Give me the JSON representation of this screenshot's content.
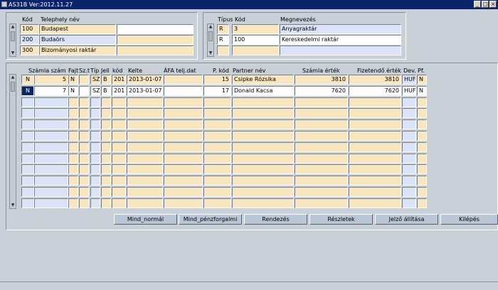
{
  "window": {
    "title": "AS31B Ver:2012.11.27"
  },
  "telephely": {
    "headers": {
      "kod": "Kód",
      "nev": "Telephely név"
    },
    "rows": [
      {
        "kod": "100",
        "nev": "Budapest"
      },
      {
        "kod": "200",
        "nev": "Budaörs"
      },
      {
        "kod": "300",
        "nev": "Bizományosi raktár"
      }
    ]
  },
  "raktar": {
    "headers": {
      "tipus": "Típus",
      "kod": "Kód",
      "megnevezes": "Megnevezés"
    },
    "rows": [
      {
        "tipus": "R",
        "kod": "3",
        "megnevezes": "Anyagraktár"
      },
      {
        "tipus": "R",
        "kod": "100",
        "megnevezes": "Kereskedelmi raktár"
      },
      {
        "tipus": "",
        "kod": "",
        "megnevezes": ""
      }
    ]
  },
  "szamlak": {
    "headers": {
      "szam": "Számla szám",
      "fajt": "Fajt",
      "szt": "Sz.t",
      "tip": "Típ",
      "jell": "Jell",
      "kod": "kód",
      "kelte": "Kelte",
      "afa": "ÁFA telj.dat",
      "pkod": "P. kód",
      "partner": "Partner név",
      "ertek": "Számla érték",
      "fizetendo": "Fizetendő érték",
      "dev": "Dev.",
      "pf": "Pf."
    },
    "rows": [
      {
        "prefix": "N",
        "szam": "5",
        "fajt": "N",
        "szt": "",
        "tip": "SZ",
        "jell": "B",
        "kod": "201",
        "kelte": "2013-01-07",
        "afa": "",
        "pkod": "15",
        "partner": "Csipke Rózsika",
        "ertek": "3810",
        "fizetendo": "3810",
        "dev": "HUF",
        "pf": "N"
      },
      {
        "prefix": "N",
        "szam": "7",
        "fajt": "N",
        "szt": "",
        "tip": "SZ",
        "jell": "B",
        "kod": "201",
        "kelte": "2013-01-07",
        "afa": "",
        "pkod": "17",
        "partner": "Donald Kacsa",
        "ertek": "7620",
        "fizetendo": "7620",
        "dev": "HUF",
        "pf": "N"
      }
    ]
  },
  "buttons": {
    "mind_normal": "Mind_normál",
    "mind_penzforgalmi": "Mind_pénzforgalmi",
    "rendezes": "Rendezés",
    "reszletek": "Részletek",
    "jelzo": "Jelző állítása",
    "kilepes": "Kilépés"
  },
  "colors": {
    "titlebar": "#0a246a",
    "row_yellow": "#f8e6c0",
    "row_blue": "#dbe4f7",
    "background": "#c9d0d8",
    "button": "#b9c6d6"
  }
}
